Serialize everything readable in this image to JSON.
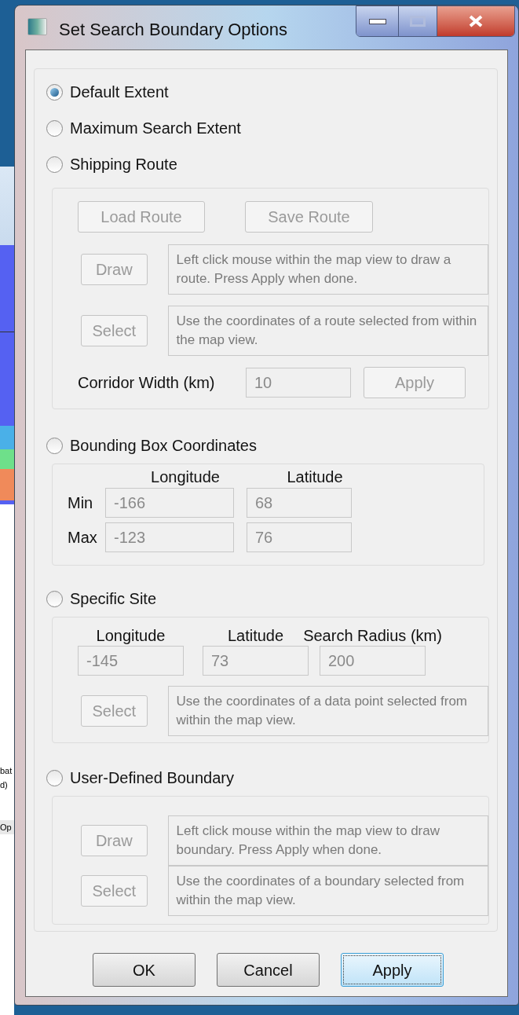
{
  "window": {
    "title": "Set Search Boundary Options"
  },
  "background": {
    "texts": [
      "bat",
      "d)",
      "Op"
    ]
  },
  "options": [
    {
      "kind": "radio",
      "label": "Default Extent",
      "selected": true
    },
    {
      "kind": "radio",
      "label": "Maximum Search Extent",
      "selected": false
    },
    {
      "kind": "route",
      "label": "Shipping Route",
      "selected": false,
      "disabled": true,
      "buttons": [
        "Load Route",
        "Save Route"
      ],
      "actions": [
        {
          "button": "Draw",
          "description": "Left click mouse within the map view to draw a route. Press Apply when done."
        },
        {
          "button": "Select",
          "description": "Use the coordinates of a route selected from within the map view."
        }
      ],
      "corridor": {
        "label": "Corridor Width (km)",
        "value": "10",
        "button": "Apply"
      }
    },
    {
      "kind": "bbox",
      "label": "Bounding Box Coordinates",
      "selected": false,
      "disabled": true,
      "columns": [
        "Longitude",
        "Latitude"
      ],
      "rows": [
        {
          "label": "Min",
          "values": [
            "-166",
            "68"
          ]
        },
        {
          "label": "Max",
          "values": [
            "-123",
            "76"
          ]
        }
      ]
    },
    {
      "kind": "site",
      "label": "Specific Site",
      "selected": false,
      "disabled": true,
      "fields": [
        {
          "label": "Longitude",
          "value": "-145"
        },
        {
          "label": "Latitude",
          "value": "73"
        },
        {
          "label": "Search Radius (km)",
          "value": "200"
        }
      ],
      "actions": [
        {
          "button": "Select",
          "description": "Use the coordinates of a data point selected from within the map view."
        }
      ]
    },
    {
      "kind": "user",
      "label": "User-Defined Boundary",
      "selected": false,
      "disabled": true,
      "actions": [
        {
          "button": "Draw",
          "description": "Left click mouse within the map view to draw boundary. Press Apply when done."
        },
        {
          "button": "Select",
          "description": "Use the coordinates of a boundary selected from within the map view."
        }
      ]
    }
  ],
  "buttons": [
    {
      "label": "OK",
      "focused": false
    },
    {
      "label": "Cancel",
      "focused": false
    },
    {
      "label": "Apply",
      "focused": true
    }
  ]
}
